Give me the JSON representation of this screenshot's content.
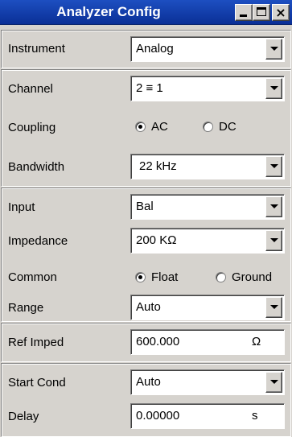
{
  "window": {
    "title": "Analyzer Config",
    "controls": {
      "minimize_icon": "minimize-icon",
      "maximize_icon": "maximize-icon",
      "close_icon": "close-icon",
      "close_glyph": "×"
    }
  },
  "instrument": {
    "label": "Instrument",
    "value": "Analog"
  },
  "channel": {
    "label": "Channel",
    "value": "2 ≡ 1"
  },
  "coupling": {
    "label": "Coupling",
    "options": [
      {
        "label": "AC",
        "selected": true
      },
      {
        "label": "DC",
        "selected": false
      }
    ]
  },
  "bandwidth": {
    "label": "Bandwidth",
    "value": "22 kHz"
  },
  "input": {
    "label": "Input",
    "value": "Bal"
  },
  "impedance": {
    "label": "Impedance",
    "value": "200 KΩ"
  },
  "common": {
    "label": "Common",
    "options": [
      {
        "label": "Float",
        "selected": true
      },
      {
        "label": "Ground",
        "selected": false
      }
    ]
  },
  "range": {
    "label": "Range",
    "value": "Auto"
  },
  "ref_imped": {
    "label": "Ref Imped",
    "value": "600.000",
    "unit": "Ω"
  },
  "start_cond": {
    "label": "Start Cond",
    "value": "Auto"
  },
  "delay": {
    "label": "Delay",
    "value": "0.00000",
    "unit": "s"
  },
  "colors": {
    "titlebar": "#0a2f96",
    "panel": "#d6d3ce",
    "field": "#ffffff"
  }
}
